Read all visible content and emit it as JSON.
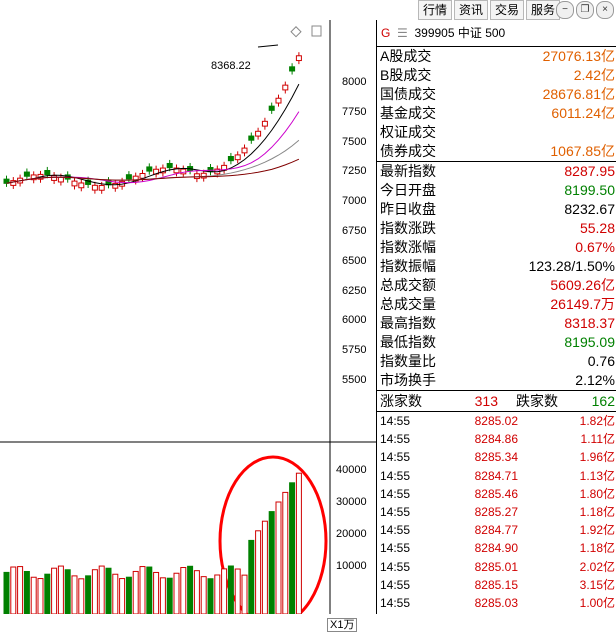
{
  "menu": [
    "行情",
    "资讯",
    "交易",
    "服务"
  ],
  "window_buttons": [
    "minimize-icon",
    "restore-icon",
    "close-icon"
  ],
  "colors": {
    "up": "#d00000",
    "down": "#008000",
    "ma_black": "#000000",
    "ma_magenta": "#cc00cc",
    "ma_gray": "#888888",
    "ma_darkred": "#800000",
    "highlight": "#ff0000"
  },
  "header": {
    "flag": "G",
    "code": "399905",
    "name": "中证 500"
  },
  "stats": [
    {
      "label": "A股成交",
      "value": "27076.13亿"
    },
    {
      "label": "B股成交",
      "value": "2.42亿"
    },
    {
      "label": "国债成交",
      "value": "28676.81亿"
    },
    {
      "label": "基金成交",
      "value": "6011.24亿"
    },
    {
      "label": "权证成交",
      "value": ""
    },
    {
      "label": "债券成交",
      "value": "1067.85亿"
    }
  ],
  "index": [
    {
      "label": "最新指数",
      "value": "8287.95",
      "color": "up"
    },
    {
      "label": "今日开盘",
      "value": "8199.50",
      "color": "down"
    },
    {
      "label": "昨日收盘",
      "value": "8232.67",
      "color": "neutral"
    },
    {
      "label": "指数涨跌",
      "value": "55.28",
      "color": "up"
    },
    {
      "label": "指数涨幅",
      "value": "0.67%",
      "color": "up"
    },
    {
      "label": "指数振幅",
      "value": "123.28/1.50%",
      "color": "neutral"
    },
    {
      "label": "总成交额",
      "value": "5609.26亿",
      "color": "up"
    },
    {
      "label": "总成交量",
      "value": "26149.7万",
      "color": "up"
    },
    {
      "label": "最高指数",
      "value": "8318.37",
      "color": "up"
    },
    {
      "label": "最低指数",
      "value": "8195.09",
      "color": "down"
    },
    {
      "label": "指数量比",
      "value": "0.76",
      "color": "neutral"
    },
    {
      "label": "市场换手",
      "value": "2.12%",
      "color": "neutral"
    }
  ],
  "breadth": {
    "up_label": "涨家数",
    "up_value": "313",
    "down_label": "跌家数",
    "down_value": "162"
  },
  "ticks": [
    {
      "time": "14:55",
      "price": "8285.02",
      "amount": "1.82亿"
    },
    {
      "time": "14:55",
      "price": "8284.86",
      "amount": "1.11亿"
    },
    {
      "time": "14:55",
      "price": "8285.34",
      "amount": "1.96亿"
    },
    {
      "time": "14:55",
      "price": "8284.71",
      "amount": "1.13亿"
    },
    {
      "time": "14:55",
      "price": "8285.46",
      "amount": "1.80亿"
    },
    {
      "time": "14:55",
      "price": "8285.27",
      "amount": "1.18亿"
    },
    {
      "time": "14:55",
      "price": "8284.77",
      "amount": "1.92亿"
    },
    {
      "time": "14:55",
      "price": "8284.90",
      "amount": "1.18亿"
    },
    {
      "time": "14:55",
      "price": "8285.01",
      "amount": "2.02亿"
    },
    {
      "time": "14:55",
      "price": "8285.15",
      "amount": "3.15亿"
    },
    {
      "time": "14:55",
      "price": "8285.03",
      "amount": "1.00亿"
    }
  ],
  "chart_data": {
    "type": "candlestick",
    "price_axis": {
      "ticks": [
        5500,
        5750,
        6000,
        6250,
        6500,
        6750,
        7000,
        7250,
        7500,
        7750,
        8000
      ]
    },
    "volume_axis": {
      "ticks": [
        10000,
        20000,
        30000,
        40000
      ],
      "unit_label": "X1万"
    },
    "peak_annotation": "8368.22"
  }
}
